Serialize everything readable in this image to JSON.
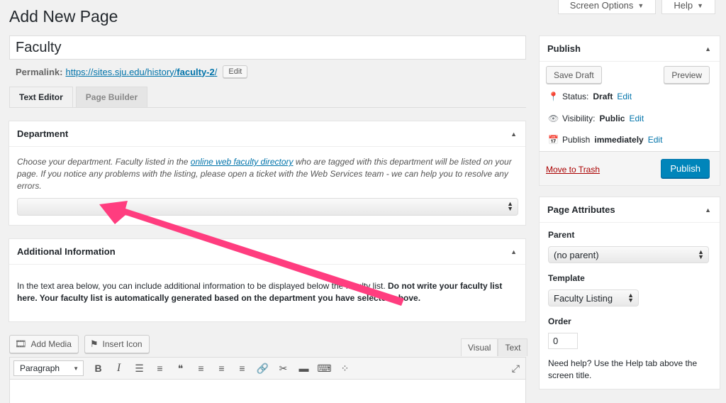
{
  "header": {
    "page_title": "Add New Page",
    "screen_options_label": "Screen Options",
    "help_label": "Help"
  },
  "post": {
    "title_value": "Faculty",
    "permalink_label": "Permalink:",
    "permalink_base": "https://sites.sju.edu/history/",
    "permalink_slug": "faculty-2",
    "permalink_trailing": "/",
    "permalink_edit": "Edit"
  },
  "tabs": [
    {
      "label": "Text Editor",
      "active": true
    },
    {
      "label": "Page Builder",
      "active": false
    }
  ],
  "department_box": {
    "title": "Department",
    "desc_before": "Choose your department. Faculty listed in the ",
    "desc_link": "online web faculty directory",
    "desc_after": " who are tagged with this department will be listed on your page. If you notice any problems with the listing, please open a ticket with the Web Services team - we can help you to resolve any errors.",
    "select_value": ""
  },
  "additional_box": {
    "title": "Additional Information",
    "text_before": "In the text area below, you can include additional information to be displayed below the faculty list. ",
    "text_bold": "Do not write your faculty list here. Your faculty list is automatically generated based on the department you have selected above."
  },
  "editor": {
    "add_media_label": "Add Media",
    "insert_icon_label": "Insert Icon",
    "visual_tab": "Visual",
    "text_tab": "Text",
    "format_value": "Paragraph",
    "toolbar_icons": [
      "bold-icon",
      "italic-icon",
      "bullet-list-icon",
      "numbered-list-icon",
      "blockquote-icon",
      "align-left-icon",
      "align-center-icon",
      "align-right-icon",
      "link-icon",
      "unlink-icon",
      "read-more-icon",
      "toolbar-toggle-icon",
      "more-icon",
      "fullscreen-icon"
    ]
  },
  "publish_box": {
    "title": "Publish",
    "save_draft_label": "Save Draft",
    "preview_label": "Preview",
    "status_label": "Status:",
    "status_value": "Draft",
    "visibility_label": "Visibility:",
    "visibility_value": "Public",
    "schedule_label": "Publish",
    "schedule_value": "immediately",
    "edit_label": "Edit",
    "trash_label": "Move to Trash",
    "publish_label": "Publish",
    "primary_color": "#0085ba"
  },
  "attributes_box": {
    "title": "Page Attributes",
    "parent_label": "Parent",
    "parent_value": "(no parent)",
    "template_label": "Template",
    "template_value": "Faculty Listing",
    "order_label": "Order",
    "order_value": "0",
    "help_text": "Need help? Use the Help tab above the screen title."
  },
  "annotation": {
    "arrow_color": "#ff3d7f"
  }
}
